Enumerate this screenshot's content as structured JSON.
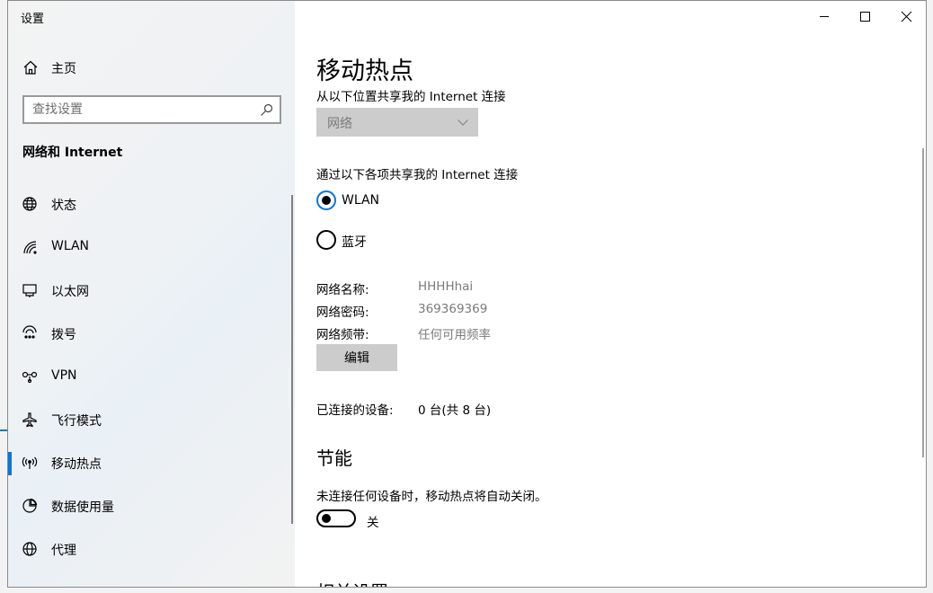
{
  "window": {
    "title": "设置"
  },
  "sidebar": {
    "home_label": "主页",
    "search_placeholder": "查找设置",
    "section_title": "网络和 Internet",
    "items": [
      {
        "label": "状态",
        "icon": "globe-icon"
      },
      {
        "label": "WLAN",
        "icon": "wifi-icon"
      },
      {
        "label": "以太网",
        "icon": "ethernet-icon"
      },
      {
        "label": "拨号",
        "icon": "dialup-icon"
      },
      {
        "label": "VPN",
        "icon": "vpn-icon"
      },
      {
        "label": "飞行模式",
        "icon": "airplane-icon"
      },
      {
        "label": "移动热点",
        "icon": "hotspot-icon",
        "active": true
      },
      {
        "label": "数据使用量",
        "icon": "data-usage-icon"
      },
      {
        "label": "代理",
        "icon": "proxy-globe-icon"
      }
    ]
  },
  "main": {
    "title": "移动热点",
    "share_from_label": "从以下位置共享我的 Internet 连接",
    "share_from_value": "网络",
    "share_over_label": "通过以下各项共享我的 Internet 连接",
    "share_options": [
      {
        "label": "WLAN",
        "checked": true
      },
      {
        "label": "蓝牙",
        "checked": false
      }
    ],
    "network_name_key": "网络名称:",
    "network_name_value": "HHHHhai",
    "network_password_key": "网络密码:",
    "network_password_value": "369369369",
    "network_band_key": "网络频带:",
    "network_band_value": "任何可用频率",
    "edit_button": "编辑",
    "connected_devices_key": "已连接的设备:",
    "connected_devices_value": "0 台(共 8 台)",
    "power_saving_title": "节能",
    "power_saving_desc": "未连接任何设备时，移动热点将自动关闭。",
    "power_saving_toggle_label": "关",
    "power_saving_on": false,
    "related_title": "相关设置"
  },
  "colors": {
    "accent": "#0078d7",
    "selection": "#0078d7"
  }
}
